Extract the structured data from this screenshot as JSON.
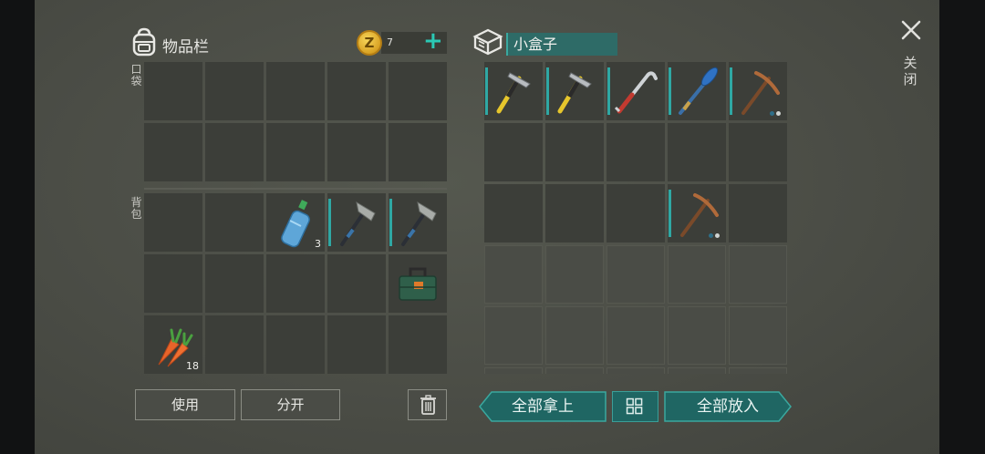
{
  "inventory": {
    "title": "物品栏",
    "coins": "7",
    "coin_symbol": "Z",
    "pocket_label": "口袋",
    "backpack_label": "背包",
    "pocket_slots": [
      {
        "item": null
      },
      {
        "item": null
      },
      {
        "item": null
      },
      {
        "item": null
      },
      {
        "item": null
      },
      {
        "item": null
      },
      {
        "item": null
      },
      {
        "item": null
      },
      {
        "item": null
      },
      {
        "item": null
      }
    ],
    "backpack_slots": [
      {
        "item": null
      },
      {
        "item": null
      },
      {
        "item": "water-bottle-icon",
        "qty": "3"
      },
      {
        "item": "stone-hatchet-icon",
        "selected": true
      },
      {
        "item": "stone-hatchet-icon",
        "selected": true
      },
      {
        "item": null
      },
      {
        "item": null
      },
      {
        "item": null
      },
      {
        "item": null
      },
      {
        "item": "toolbox-icon"
      },
      {
        "item": "carrot-icon",
        "qty": "18"
      },
      {
        "item": null
      },
      {
        "item": null
      },
      {
        "item": null
      },
      {
        "item": null
      }
    ]
  },
  "container": {
    "name": "小盒子",
    "slots": [
      {
        "item": "hammer-icon",
        "selected": true
      },
      {
        "item": "hammer-icon",
        "selected": true
      },
      {
        "item": "crowbar-icon",
        "selected": true
      },
      {
        "item": "oar-icon",
        "selected": true
      },
      {
        "item": "pickaxe-icon",
        "selected": true,
        "dots": true
      },
      {
        "item": null
      },
      {
        "item": null
      },
      {
        "item": null
      },
      {
        "item": null
      },
      {
        "item": null
      },
      {
        "item": null
      },
      {
        "item": null
      },
      {
        "item": null
      },
      {
        "item": "pickaxe-icon",
        "selected": true,
        "dots": true
      },
      {
        "item": null
      }
    ],
    "locked_rows": 3
  },
  "actions": {
    "use": "使用",
    "split": "分开",
    "take_all": "全部拿上",
    "put_all": "全部放入"
  },
  "close": {
    "label": "关闭"
  },
  "colors": {
    "accent": "#2fa8a4",
    "teal_button": "#1f6663",
    "slot": "#3c3e39"
  }
}
